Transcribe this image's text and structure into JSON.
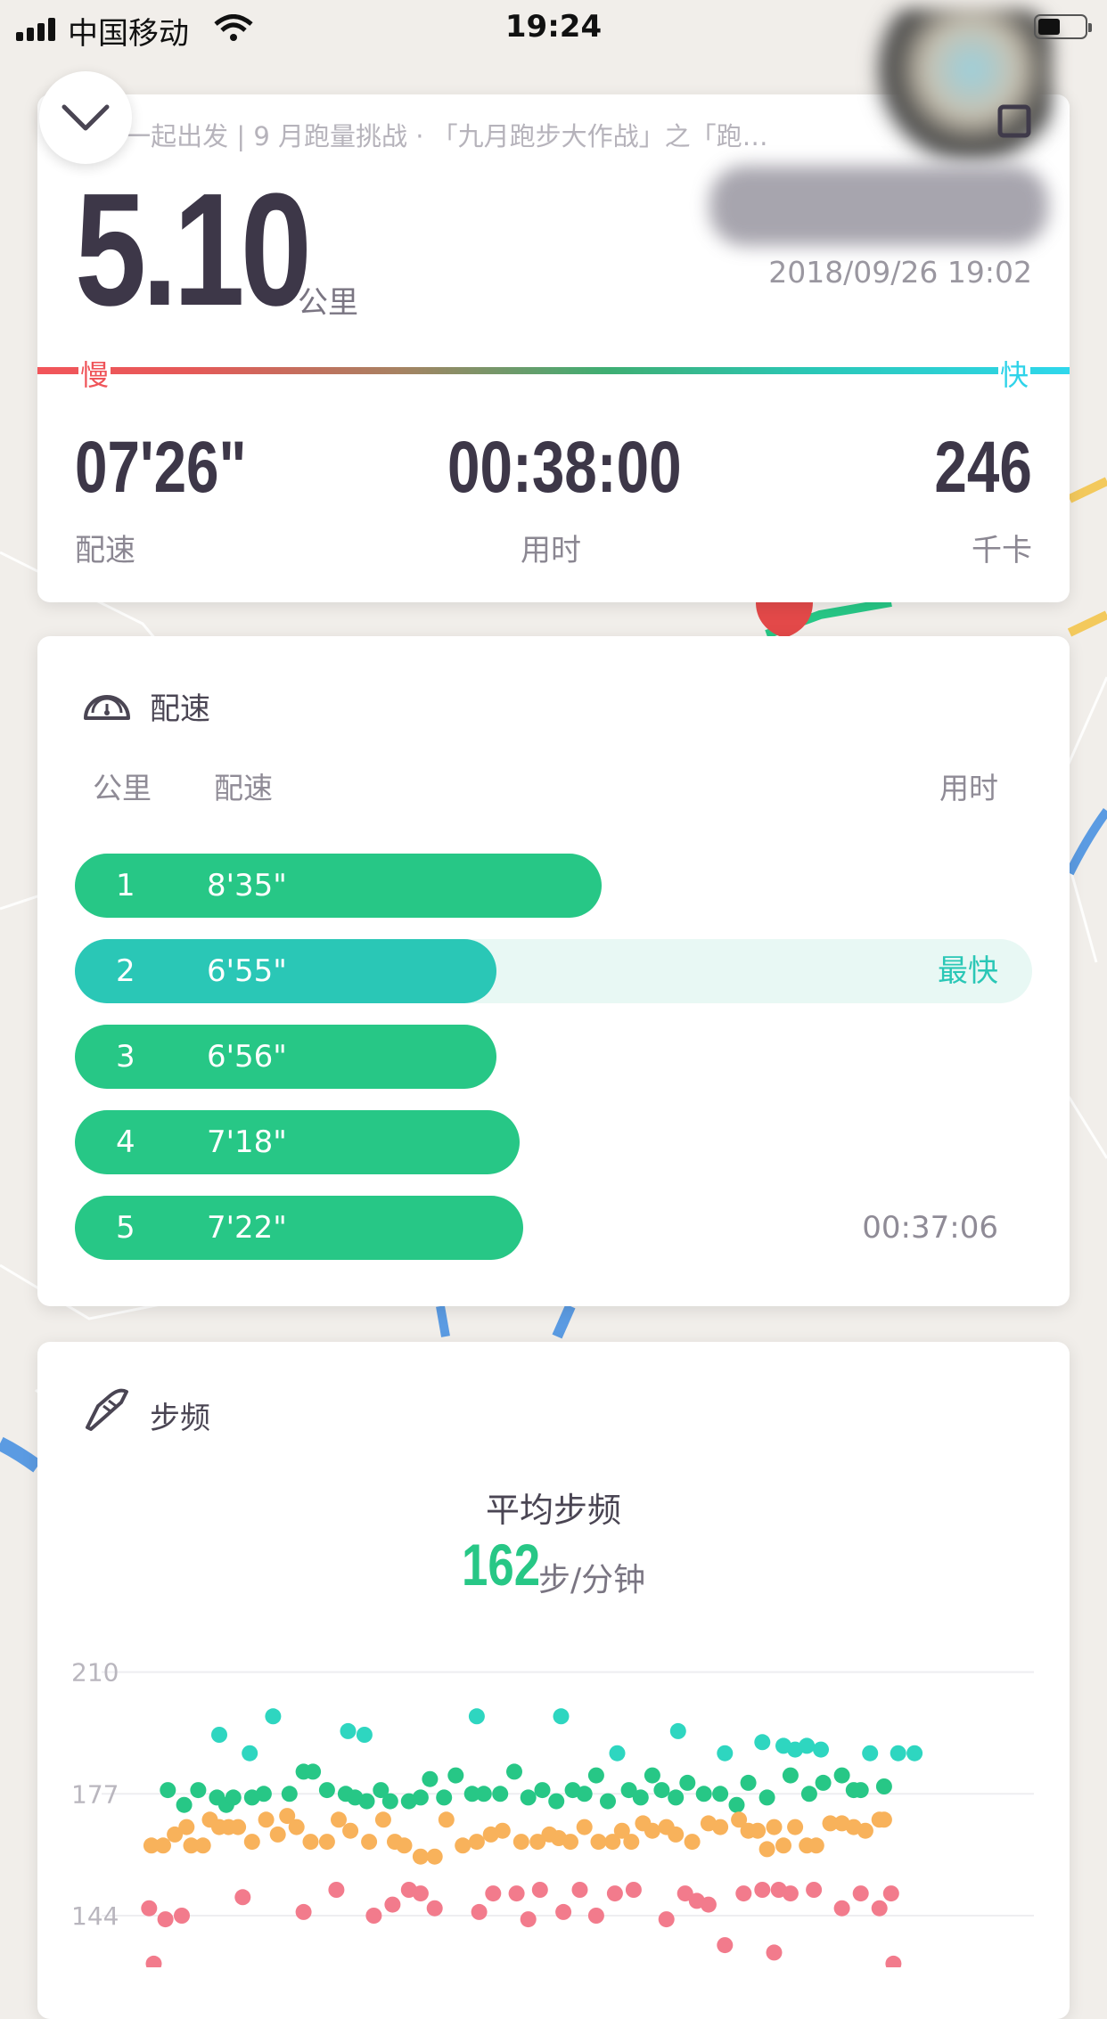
{
  "status_bar": {
    "carrier": "中国移动",
    "time": "19:24"
  },
  "header": {
    "subtitle": "P · 一起出发 | 9 月跑量挑战 · 「九月跑步大作战」之「跑…"
  },
  "summary": {
    "distance": "5.10",
    "distance_unit": "公里",
    "datetime": "2018/09/26 19:02",
    "slow_label": "慢",
    "fast_label": "快",
    "pace_value": "07'26\"",
    "pace_label": "配速",
    "duration_value": "00:38:00",
    "duration_label": "用时",
    "calories_value": "246",
    "calories_label": "千卡"
  },
  "pace_section": {
    "title": "配速",
    "col_km": "公里",
    "col_pace": "配速",
    "col_time": "用时",
    "fastest_label": "最快",
    "rows": [
      {
        "km": "1",
        "pace": "8'35\"",
        "right": "",
        "fraction": 0.55
      },
      {
        "km": "2",
        "pace": "6'55\"",
        "right": "最快",
        "fraction": 0.44
      },
      {
        "km": "3",
        "pace": "6'56\"",
        "right": "",
        "fraction": 0.44
      },
      {
        "km": "4",
        "pace": "7'18\"",
        "right": "",
        "fraction": 0.465
      },
      {
        "km": "5",
        "pace": "7'22\"",
        "right": "00:37:06",
        "fraction": 0.468
      }
    ]
  },
  "cadence_section": {
    "title": "步频",
    "avg_label": "平均步频",
    "avg_value": "162",
    "avg_unit": "步/分钟"
  },
  "colors": {
    "accent": "#27c786",
    "fastest": "#2ac7b6",
    "slow": "#ef5459",
    "fast": "#2fd7ec",
    "orange": "#f8b25b",
    "pink": "#f27b8c"
  },
  "chart_data": {
    "type": "scatter",
    "ylim": [
      130,
      214
    ],
    "y_ticks": [
      "210",
      "177",
      "144"
    ],
    "x_range": [
      0,
      38
    ],
    "series": [
      {
        "color": "#2ed6c0",
        "points": [
          [
            3.2,
            193
          ],
          [
            4.5,
            188
          ],
          [
            5.5,
            198
          ],
          [
            8.7,
            194
          ],
          [
            9.4,
            193
          ],
          [
            14.2,
            198
          ],
          [
            17.8,
            198
          ],
          [
            20.2,
            188
          ],
          [
            22.8,
            194
          ],
          [
            24.8,
            188
          ],
          [
            26.4,
            191
          ],
          [
            27.8,
            189
          ],
          [
            27.3,
            190
          ],
          [
            28.3,
            190
          ],
          [
            28.9,
            189
          ],
          [
            31.0,
            188
          ],
          [
            32.2,
            188
          ],
          [
            32.9,
            188
          ]
        ]
      },
      {
        "color": "#27c786",
        "points": [
          [
            1.0,
            178
          ],
          [
            1.7,
            174
          ],
          [
            2.3,
            178
          ],
          [
            3.1,
            176
          ],
          [
            3.5,
            174
          ],
          [
            3.8,
            176
          ],
          [
            4.6,
            176
          ],
          [
            5.1,
            177
          ],
          [
            6.2,
            177
          ],
          [
            6.8,
            183
          ],
          [
            7.2,
            183
          ],
          [
            7.8,
            178
          ],
          [
            8.6,
            177
          ],
          [
            9.0,
            176
          ],
          [
            9.5,
            175
          ],
          [
            10.1,
            178
          ],
          [
            10.5,
            175
          ],
          [
            11.3,
            175
          ],
          [
            11.8,
            176
          ],
          [
            12.2,
            181
          ],
          [
            12.8,
            176
          ],
          [
            13.3,
            182
          ],
          [
            14.0,
            177
          ],
          [
            14.5,
            177
          ],
          [
            15.2,
            177
          ],
          [
            15.8,
            183
          ],
          [
            16.4,
            176
          ],
          [
            17.0,
            178
          ],
          [
            17.6,
            175
          ],
          [
            18.3,
            178
          ],
          [
            18.8,
            177
          ],
          [
            19.3,
            182
          ],
          [
            19.8,
            175
          ],
          [
            20.7,
            178
          ],
          [
            21.2,
            176
          ],
          [
            21.7,
            182
          ],
          [
            22.1,
            178
          ],
          [
            22.7,
            176
          ],
          [
            23.2,
            180
          ],
          [
            23.9,
            177
          ],
          [
            24.6,
            177
          ],
          [
            25.3,
            174
          ],
          [
            25.8,
            180
          ],
          [
            26.6,
            176
          ],
          [
            27.6,
            182
          ],
          [
            28.4,
            177
          ],
          [
            29.0,
            180
          ],
          [
            29.8,
            182
          ],
          [
            30.3,
            178
          ],
          [
            30.6,
            178
          ],
          [
            31.6,
            179
          ]
        ]
      },
      {
        "color": "#f8b25b",
        "points": [
          [
            0.3,
            163
          ],
          [
            0.8,
            163
          ],
          [
            1.3,
            166
          ],
          [
            1.8,
            168
          ],
          [
            2.0,
            163
          ],
          [
            2.5,
            163
          ],
          [
            2.8,
            170
          ],
          [
            3.2,
            168
          ],
          [
            3.6,
            168
          ],
          [
            4.0,
            168
          ],
          [
            4.6,
            164
          ],
          [
            5.2,
            170
          ],
          [
            5.7,
            166
          ],
          [
            6.1,
            171
          ],
          [
            6.5,
            168
          ],
          [
            7.1,
            164
          ],
          [
            7.8,
            164
          ],
          [
            8.3,
            170
          ],
          [
            8.8,
            167
          ],
          [
            9.6,
            164
          ],
          [
            10.2,
            170
          ],
          [
            10.7,
            164
          ],
          [
            11.1,
            163
          ],
          [
            11.8,
            160
          ],
          [
            12.4,
            160
          ],
          [
            12.9,
            170
          ],
          [
            13.6,
            163
          ],
          [
            14.2,
            164
          ],
          [
            14.8,
            166
          ],
          [
            15.3,
            167
          ],
          [
            16.1,
            164
          ],
          [
            16.8,
            164
          ],
          [
            17.3,
            166
          ],
          [
            17.7,
            165
          ],
          [
            18.2,
            164
          ],
          [
            18.8,
            168
          ],
          [
            19.4,
            164
          ],
          [
            20.0,
            164
          ],
          [
            20.4,
            167
          ],
          [
            20.8,
            164
          ],
          [
            21.3,
            169
          ],
          [
            21.7,
            167
          ],
          [
            22.3,
            168
          ],
          [
            22.7,
            166
          ],
          [
            23.4,
            164
          ],
          [
            24.1,
            169
          ],
          [
            24.6,
            168
          ],
          [
            25.4,
            170
          ],
          [
            25.8,
            167
          ],
          [
            26.2,
            167
          ],
          [
            26.6,
            162
          ],
          [
            26.9,
            168
          ],
          [
            27.3,
            163
          ],
          [
            27.8,
            168
          ],
          [
            28.3,
            163
          ],
          [
            28.7,
            163
          ],
          [
            29.3,
            169
          ],
          [
            29.8,
            169
          ],
          [
            30.3,
            168
          ],
          [
            30.8,
            167
          ],
          [
            31.4,
            170
          ],
          [
            31.6,
            170
          ]
        ]
      },
      {
        "color": "#f27b8c",
        "points": [
          [
            0.2,
            146
          ],
          [
            0.9,
            143
          ],
          [
            1.6,
            144
          ],
          [
            4.2,
            149
          ],
          [
            6.8,
            145
          ],
          [
            8.2,
            151
          ],
          [
            9.8,
            144
          ],
          [
            10.6,
            147
          ],
          [
            11.3,
            151
          ],
          [
            11.8,
            150
          ],
          [
            12.4,
            146
          ],
          [
            14.3,
            145
          ],
          [
            14.9,
            150
          ],
          [
            15.9,
            150
          ],
          [
            16.4,
            143
          ],
          [
            16.9,
            151
          ],
          [
            17.9,
            145
          ],
          [
            18.6,
            151
          ],
          [
            19.3,
            144
          ],
          [
            20.1,
            150
          ],
          [
            20.9,
            151
          ],
          [
            22.3,
            143
          ],
          [
            23.1,
            150
          ],
          [
            23.6,
            148
          ],
          [
            24.1,
            147
          ],
          [
            25.6,
            150
          ],
          [
            26.4,
            151
          ],
          [
            27.1,
            151
          ],
          [
            27.6,
            150
          ],
          [
            28.6,
            151
          ],
          [
            29.8,
            146
          ],
          [
            30.6,
            150
          ],
          [
            31.4,
            146
          ],
          [
            31.9,
            150
          ],
          [
            24.8,
            136
          ],
          [
            26.9,
            134
          ],
          [
            0.4,
            131
          ],
          [
            32.0,
            131
          ]
        ]
      }
    ]
  }
}
